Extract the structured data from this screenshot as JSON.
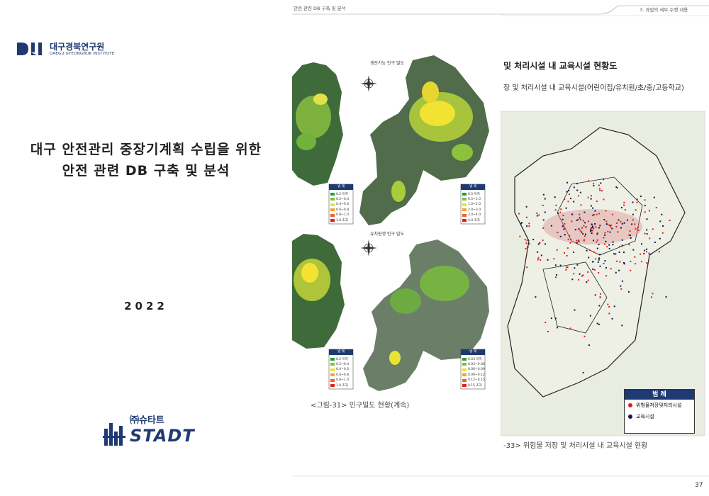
{
  "cover": {
    "logo_ko": "대구경북연구원",
    "logo_en": "DAEGU GYEONGBUK INSTITUTE",
    "title_line1": "대구 안전관리 중장기계획 수립을 위한",
    "title_line2": "안전 관련 DB 구축 및 분석",
    "year": "2022",
    "company_ko": "㈜슈타트",
    "company_en": "STADT"
  },
  "middle_page": {
    "running_header": "안전 관련 DB 구축 및 분석",
    "map1_title": "생산가능 인구 밀도",
    "map2_title": "유치원생 인구 밀도",
    "legend_title": "범 례",
    "legend1": [
      "0.2 이하",
      "0.2~0.4",
      "0.4~0.6",
      "0.6~0.8",
      "0.8~1.0",
      "1.0 초과"
    ],
    "legend2": [
      "0.5 이하",
      "0.5~1.0",
      "1.0~2.0",
      "2.0~3.0",
      "3.0~4.0",
      "4.0 초과"
    ],
    "legend3": [
      "0.2 이하",
      "0.2~0.4",
      "0.4~0.6",
      "0.6~0.8",
      "0.8~1.0",
      "1.0 초과"
    ],
    "legend4": [
      "0.03 이하",
      "0.03~0.06",
      "0.06~0.09",
      "0.09~0.12",
      "0.12~0.15",
      "0.15 초과"
    ],
    "caption": "<그림-31> 인구밀도 현황(계속)"
  },
  "right_page": {
    "running_header": "3. 과업의 세부 수행 내용",
    "heading": "및 처리시설 내 교육시설 현황도",
    "subtext": "장 및 처리시설 내 교육시설(어린이집/유치원/초/중/고등학교)",
    "legend_title": "범 례",
    "legend_items": [
      {
        "label": "위험물저장및처리시설",
        "color": "#e41a1c"
      },
      {
        "label": "교육시설",
        "color": "#0d1b4c"
      }
    ],
    "caption": "-33> 위험물 저장 및 처리시설 내 교육시설 현황",
    "page_number": "37"
  }
}
